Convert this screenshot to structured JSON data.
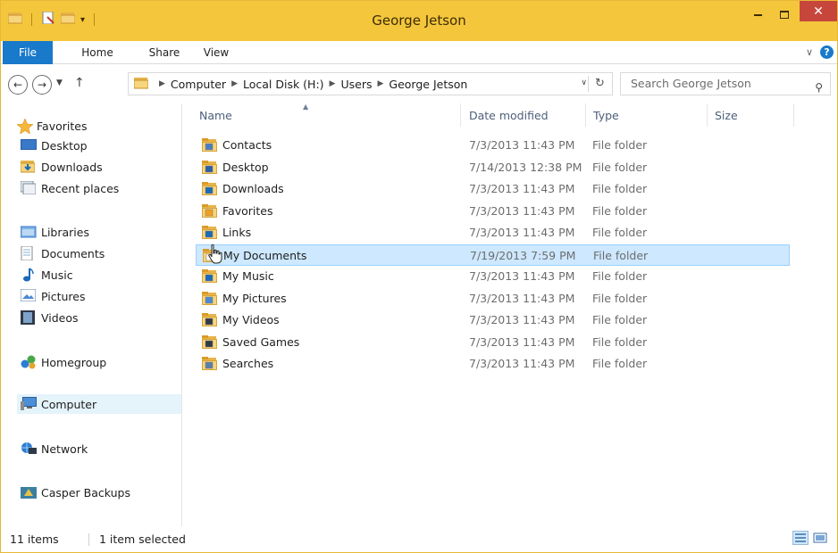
{
  "window": {
    "title": "George Jetson"
  },
  "ribbon": {
    "tabs": [
      {
        "label": "File"
      },
      {
        "label": "Home"
      },
      {
        "label": "Share"
      },
      {
        "label": "View"
      }
    ]
  },
  "address": {
    "crumbs": [
      "Computer",
      "Local Disk (H:)",
      "Users",
      "George Jetson"
    ]
  },
  "search": {
    "placeholder": "Search George Jetson"
  },
  "navpane": {
    "favorites": {
      "label": "Favorites",
      "items": [
        "Desktop",
        "Downloads",
        "Recent places"
      ]
    },
    "libraries": {
      "label": "Libraries",
      "items": [
        "Documents",
        "Music",
        "Pictures",
        "Videos"
      ]
    },
    "homegroup": "Homegroup",
    "computer": "Computer",
    "network": "Network",
    "casper": "Casper Backups"
  },
  "columns": {
    "name": "Name",
    "date": "Date modified",
    "type": "Type",
    "size": "Size"
  },
  "files": [
    {
      "name": "Contacts",
      "date": "7/3/2013 11:43 PM",
      "type": "File folder",
      "icon": "contacts-folder-icon"
    },
    {
      "name": "Desktop",
      "date": "7/14/2013 12:38 PM",
      "type": "File folder",
      "icon": "desktop-folder-icon"
    },
    {
      "name": "Downloads",
      "date": "7/3/2013 11:43 PM",
      "type": "File folder",
      "icon": "downloads-folder-icon"
    },
    {
      "name": "Favorites",
      "date": "7/3/2013 11:43 PM",
      "type": "File folder",
      "icon": "favorites-folder-icon"
    },
    {
      "name": "Links",
      "date": "7/3/2013 11:43 PM",
      "type": "File folder",
      "icon": "links-folder-icon"
    },
    {
      "name": "My Documents",
      "date": "7/19/2013 7:59 PM",
      "type": "File folder",
      "icon": "documents-folder-icon"
    },
    {
      "name": "My Music",
      "date": "7/3/2013 11:43 PM",
      "type": "File folder",
      "icon": "music-folder-icon"
    },
    {
      "name": "My Pictures",
      "date": "7/3/2013 11:43 PM",
      "type": "File folder",
      "icon": "pictures-folder-icon"
    },
    {
      "name": "My Videos",
      "date": "7/3/2013 11:43 PM",
      "type": "File folder",
      "icon": "videos-folder-icon"
    },
    {
      "name": "Saved Games",
      "date": "7/3/2013 11:43 PM",
      "type": "File folder",
      "icon": "saved-games-folder-icon"
    },
    {
      "name": "Searches",
      "date": "7/3/2013 11:43 PM",
      "type": "File folder",
      "icon": "searches-folder-icon"
    }
  ],
  "selected_file": "My Documents",
  "status": {
    "count": "11 items",
    "selection": "1 item selected"
  },
  "colors": {
    "titlebar": "#f4c63c",
    "file_tab": "#1979ca",
    "close": "#c7463b",
    "selection": "#cde8ff"
  }
}
